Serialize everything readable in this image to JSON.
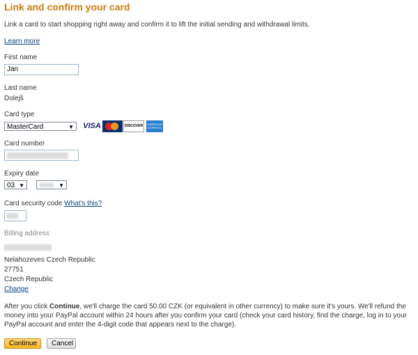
{
  "title": "Link and confirm your card",
  "intro": "Link a card to start shopping right away and confirm it to lift the initial sending and withdrawal limits.",
  "learn_more": "Learn more",
  "first_name": {
    "label": "First name",
    "value": "Jan"
  },
  "last_name": {
    "label": "Last name",
    "value": "Dolejš"
  },
  "card_type": {
    "label": "Card type",
    "selected": "MasterCard"
  },
  "card_logos": {
    "visa": "VISA",
    "mastercard": "MasterCard",
    "discover": "DISCOVER",
    "amex": "AMERICAN EXPRESS"
  },
  "card_number": {
    "label": "Card number"
  },
  "expiry": {
    "label": "Expiry date",
    "month": "03"
  },
  "security": {
    "label": "Card security code",
    "whats_this": "What's this?"
  },
  "billing": {
    "label": "Billing address",
    "line_city": "Nelahozeves  Czech Republic",
    "line_zip": "27751",
    "line_country": "Czech Republic",
    "change": "Change"
  },
  "notice": {
    "before": "After you click ",
    "bold": "Continue",
    "after": ", we'll charge the card 50.00 CZK (or equivalent in other currency) to make sure it's yours. We'll refund the money into your PayPal account within 24 hours after you confirm your card (check your card history, find the charge, log in to your PayPal account and enter the 4-digit code that appears next to the charge)."
  },
  "buttons": {
    "continue": "Continue",
    "cancel": "Cancel"
  },
  "colors": {
    "title": "#cc7a0f",
    "link": "#084482",
    "primary_button": "#f7b524"
  }
}
